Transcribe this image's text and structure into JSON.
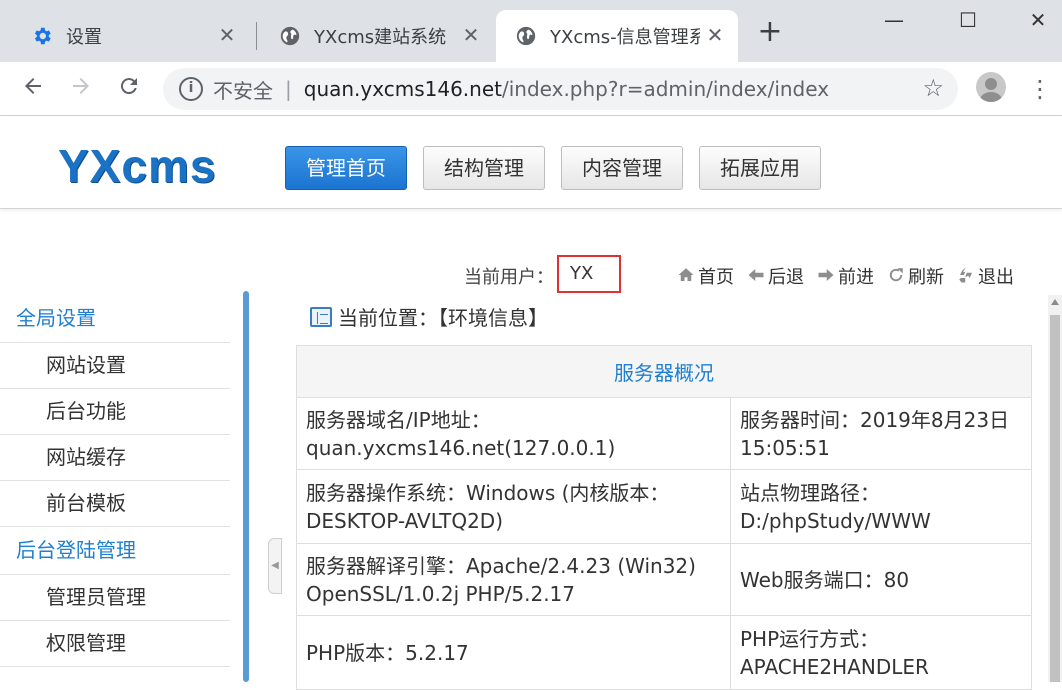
{
  "browser": {
    "tabs": [
      {
        "title": "设置",
        "icon": "gear-icon",
        "active": false
      },
      {
        "title": "YXcms建站系统",
        "icon": "globe-icon",
        "active": false
      },
      {
        "title": "YXcms-信息管理系",
        "icon": "globe-icon",
        "active": true
      }
    ],
    "new_tab_glyph": "+",
    "window": {
      "minimize": "—",
      "maximize": "☐",
      "close": "✕"
    },
    "address": {
      "security_label": "不安全",
      "divider": "|",
      "host": "quan.yxcms146.net",
      "path": "/index.php?r=admin/index/index"
    }
  },
  "header": {
    "logo": "YXcms",
    "nav": [
      {
        "label": "管理首页",
        "active": true
      },
      {
        "label": "结构管理",
        "active": false
      },
      {
        "label": "内容管理",
        "active": false
      },
      {
        "label": "拓展应用",
        "active": false
      }
    ]
  },
  "userbar": {
    "current_user_label": "当前用户：",
    "current_user": "YX",
    "links": [
      {
        "label": "首页",
        "icon": "home-icon"
      },
      {
        "label": "后退",
        "icon": "back-arrow-icon"
      },
      {
        "label": "前进",
        "icon": "forward-arrow-icon"
      },
      {
        "label": "刷新",
        "icon": "refresh-icon"
      },
      {
        "label": "退出",
        "icon": "exit-icon"
      }
    ]
  },
  "sidebar": {
    "groups": [
      {
        "title": "全局设置",
        "items": [
          "网站设置",
          "后台功能",
          "网站缓存",
          "前台模板"
        ]
      },
      {
        "title": "后台登陆管理",
        "items": [
          "管理员管理",
          "权限管理"
        ]
      }
    ]
  },
  "main": {
    "breadcrumb": "当前位置：【环境信息】",
    "table_title": "服务器概况",
    "rows": [
      {
        "left_label": "服务器域名/IP地址：",
        "left_value": "quan.yxcms146.net(127.0.0.1)",
        "right_label": "服务器时间：2019年8月23日",
        "right_value": "15:05:51"
      },
      {
        "left_label": "服务器操作系统：Windows (内核版本：",
        "left_value": "DESKTOP-AVLTQ2D)",
        "right_label": "站点物理路径：",
        "right_value": "D:/phpStudy/WWW"
      },
      {
        "left_label": "服务器解译引擎：Apache/2.4.23 (Win32)",
        "left_value": "OpenSSL/1.0.2j PHP/5.2.17",
        "right_label": "Web服务端口：80",
        "right_value": ""
      },
      {
        "left_label": "PHP版本：5.2.17",
        "left_value": "",
        "right_label": "PHP运行方式：",
        "right_value": "APACHE2HANDLER"
      }
    ]
  },
  "colors": {
    "accent": "#1b74d0",
    "link_blue": "#1f7fd1",
    "highlight_red": "#e03131"
  }
}
